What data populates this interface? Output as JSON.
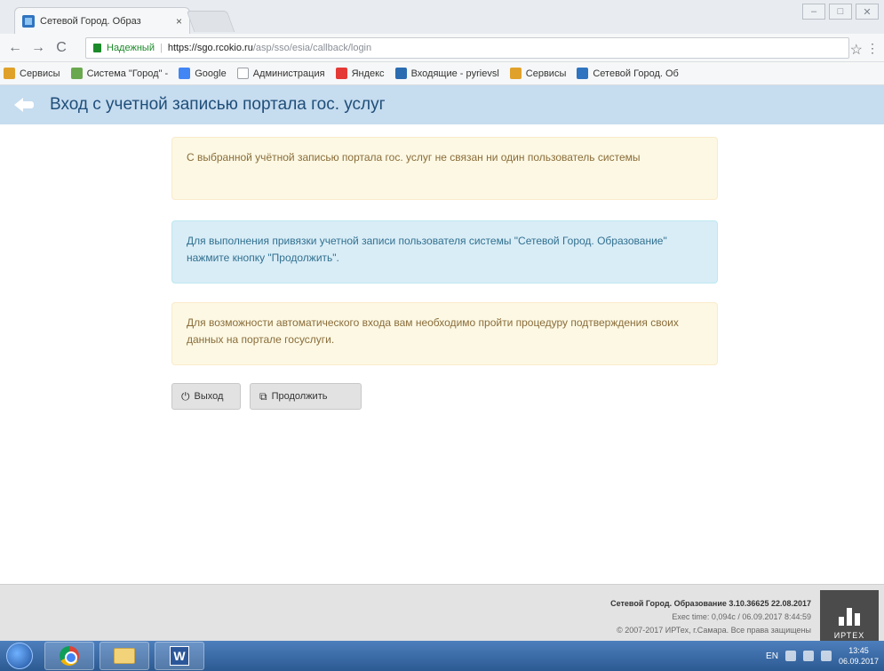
{
  "browser": {
    "tab_title": "Сетевой Город. Образ",
    "tab_close": "×",
    "secure_label": "Надежный",
    "url_separator": "|",
    "url_host": "https://sgo.rcokio.ru",
    "url_path": "/asp/sso/esia/callback/login",
    "window_buttons": [
      "–",
      "□",
      "✕"
    ],
    "back_glyph": "←",
    "forward_glyph": "→",
    "reload_glyph": "C",
    "star_glyph": "☆",
    "menu_glyph": "⋮"
  },
  "bookmarks": [
    {
      "label": "Сервисы",
      "color": "#e0a12a"
    },
    {
      "label": "Система \"Город\" - ",
      "color": "#6aa84f"
    },
    {
      "label": "Google",
      "color": "#4285f4"
    },
    {
      "label": "Администрация",
      "color": "#9aa0a6"
    },
    {
      "label": "Яндекс",
      "color": "#e53935"
    },
    {
      "label": "Входящие - pyrievsl",
      "color": "#2b6cb0"
    },
    {
      "label": "Сервисы",
      "color": "#e0a12a"
    },
    {
      "label": "Сетевой Город. Об",
      "color": "#2f74c0"
    }
  ],
  "page": {
    "title": "Вход с учетной записью портала гос. услуг",
    "alert_1": "С выбранной учётной записью портала гос. услуг не связан ни один пользователь системы",
    "alert_2": "Для выполнения привязки учетной записи пользователя системы \"Сетевой Город. Образование\" нажмите кнопку \"Продолжить\".",
    "alert_3": "Для возможности автоматического входа вам необходимо пройти процедуру подтверждения своих данных на портале госуслуги.",
    "exit_label": "Выход",
    "continue_label": "Продолжить",
    "exit_icon": "⏻",
    "continue_icon": "⧉"
  },
  "footer": {
    "app_version": "Сетевой Город. Образование 3.10.36625 22.08.2017",
    "exec_time": "Exec time: 0,094с / 06.09.2017 8:44:59",
    "copyright": "© 2007-2017 ИРТех, г.Самара. Все права защищены",
    "logo_text": "ИРТЕХ"
  },
  "taskbar": {
    "word_letter": "W",
    "lang": "EN",
    "time": "13:45",
    "date": "06.09.2017"
  },
  "colors": {
    "header_bg": "#c6dcef",
    "title_color": "#1f4e79",
    "warn_bg": "#fcf8e3",
    "info_bg": "#d9edf7"
  }
}
